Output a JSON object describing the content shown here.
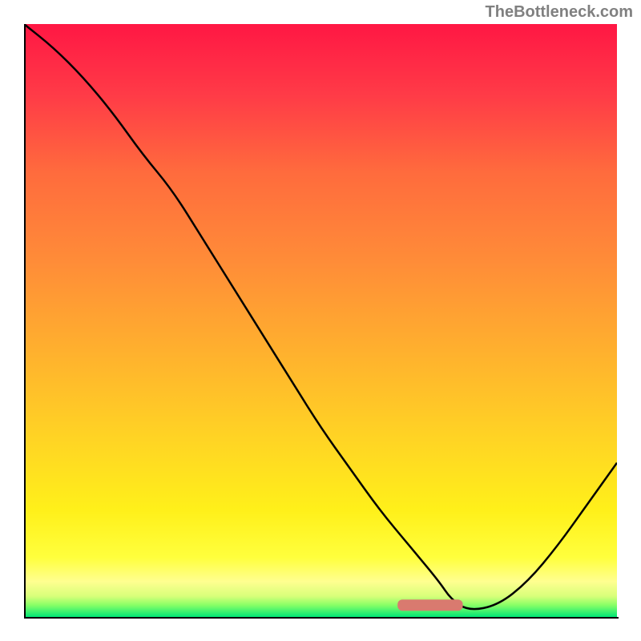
{
  "watermark": "TheBottleneck.com",
  "colors": {
    "gradient_top": "#ff1744",
    "gradient_bottom": "#00e676",
    "curve": "#000000",
    "marker": "#d97a6f",
    "axes": "#000000"
  },
  "chart_data": {
    "type": "line",
    "title": "",
    "xlabel": "",
    "ylabel": "",
    "xlim": [
      0,
      100
    ],
    "ylim": [
      0,
      100
    ],
    "x": [
      0,
      5,
      10,
      15,
      20,
      25,
      30,
      35,
      40,
      45,
      50,
      55,
      60,
      65,
      70,
      72,
      75,
      80,
      85,
      90,
      95,
      100
    ],
    "values": [
      100,
      96,
      91,
      85,
      78,
      72,
      64,
      56,
      48,
      40,
      32,
      25,
      18,
      12,
      6,
      3,
      1,
      2,
      6,
      12,
      19,
      26
    ],
    "marker": {
      "x_start": 63,
      "x_end": 74,
      "y": 2
    }
  }
}
